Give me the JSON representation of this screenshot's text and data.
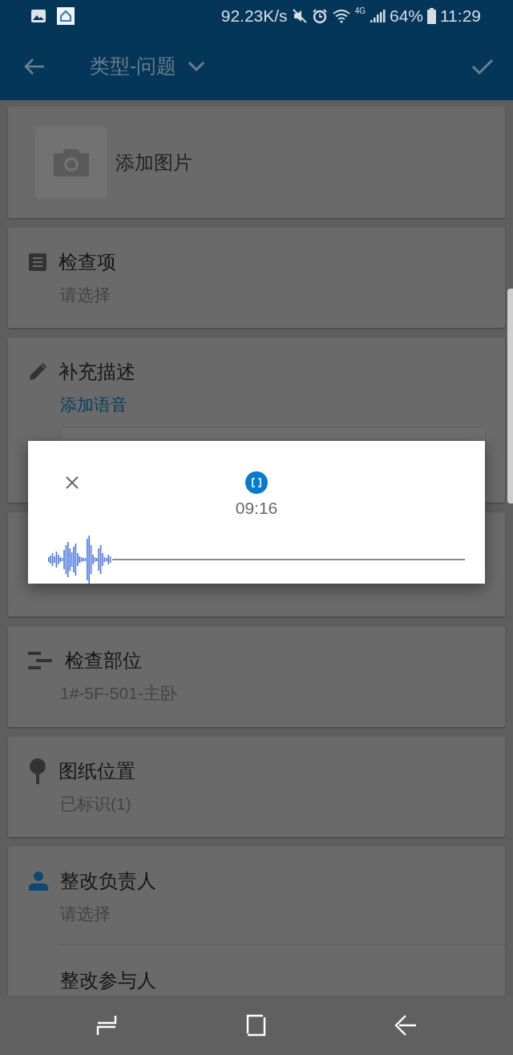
{
  "status_bar": {
    "speed": "92.23K/s",
    "network": "4G",
    "battery": "64%",
    "time": "11:29"
  },
  "app_bar": {
    "title": "类型-问题"
  },
  "photo": {
    "label": "添加图片"
  },
  "inspection_item": {
    "label": "检查项",
    "value": "请选择"
  },
  "description": {
    "label": "补充描述",
    "link": "添加语音"
  },
  "location": {
    "label": "检查部位",
    "value": "1#-5F-501-主卧"
  },
  "drawing_position": {
    "label": "图纸位置",
    "value": "已标识(1)"
  },
  "rectification": {
    "owner_label": "整改负责人",
    "owner_value": "请选择",
    "participants_label": "整改参与人"
  },
  "recorder": {
    "time": "09:16"
  }
}
